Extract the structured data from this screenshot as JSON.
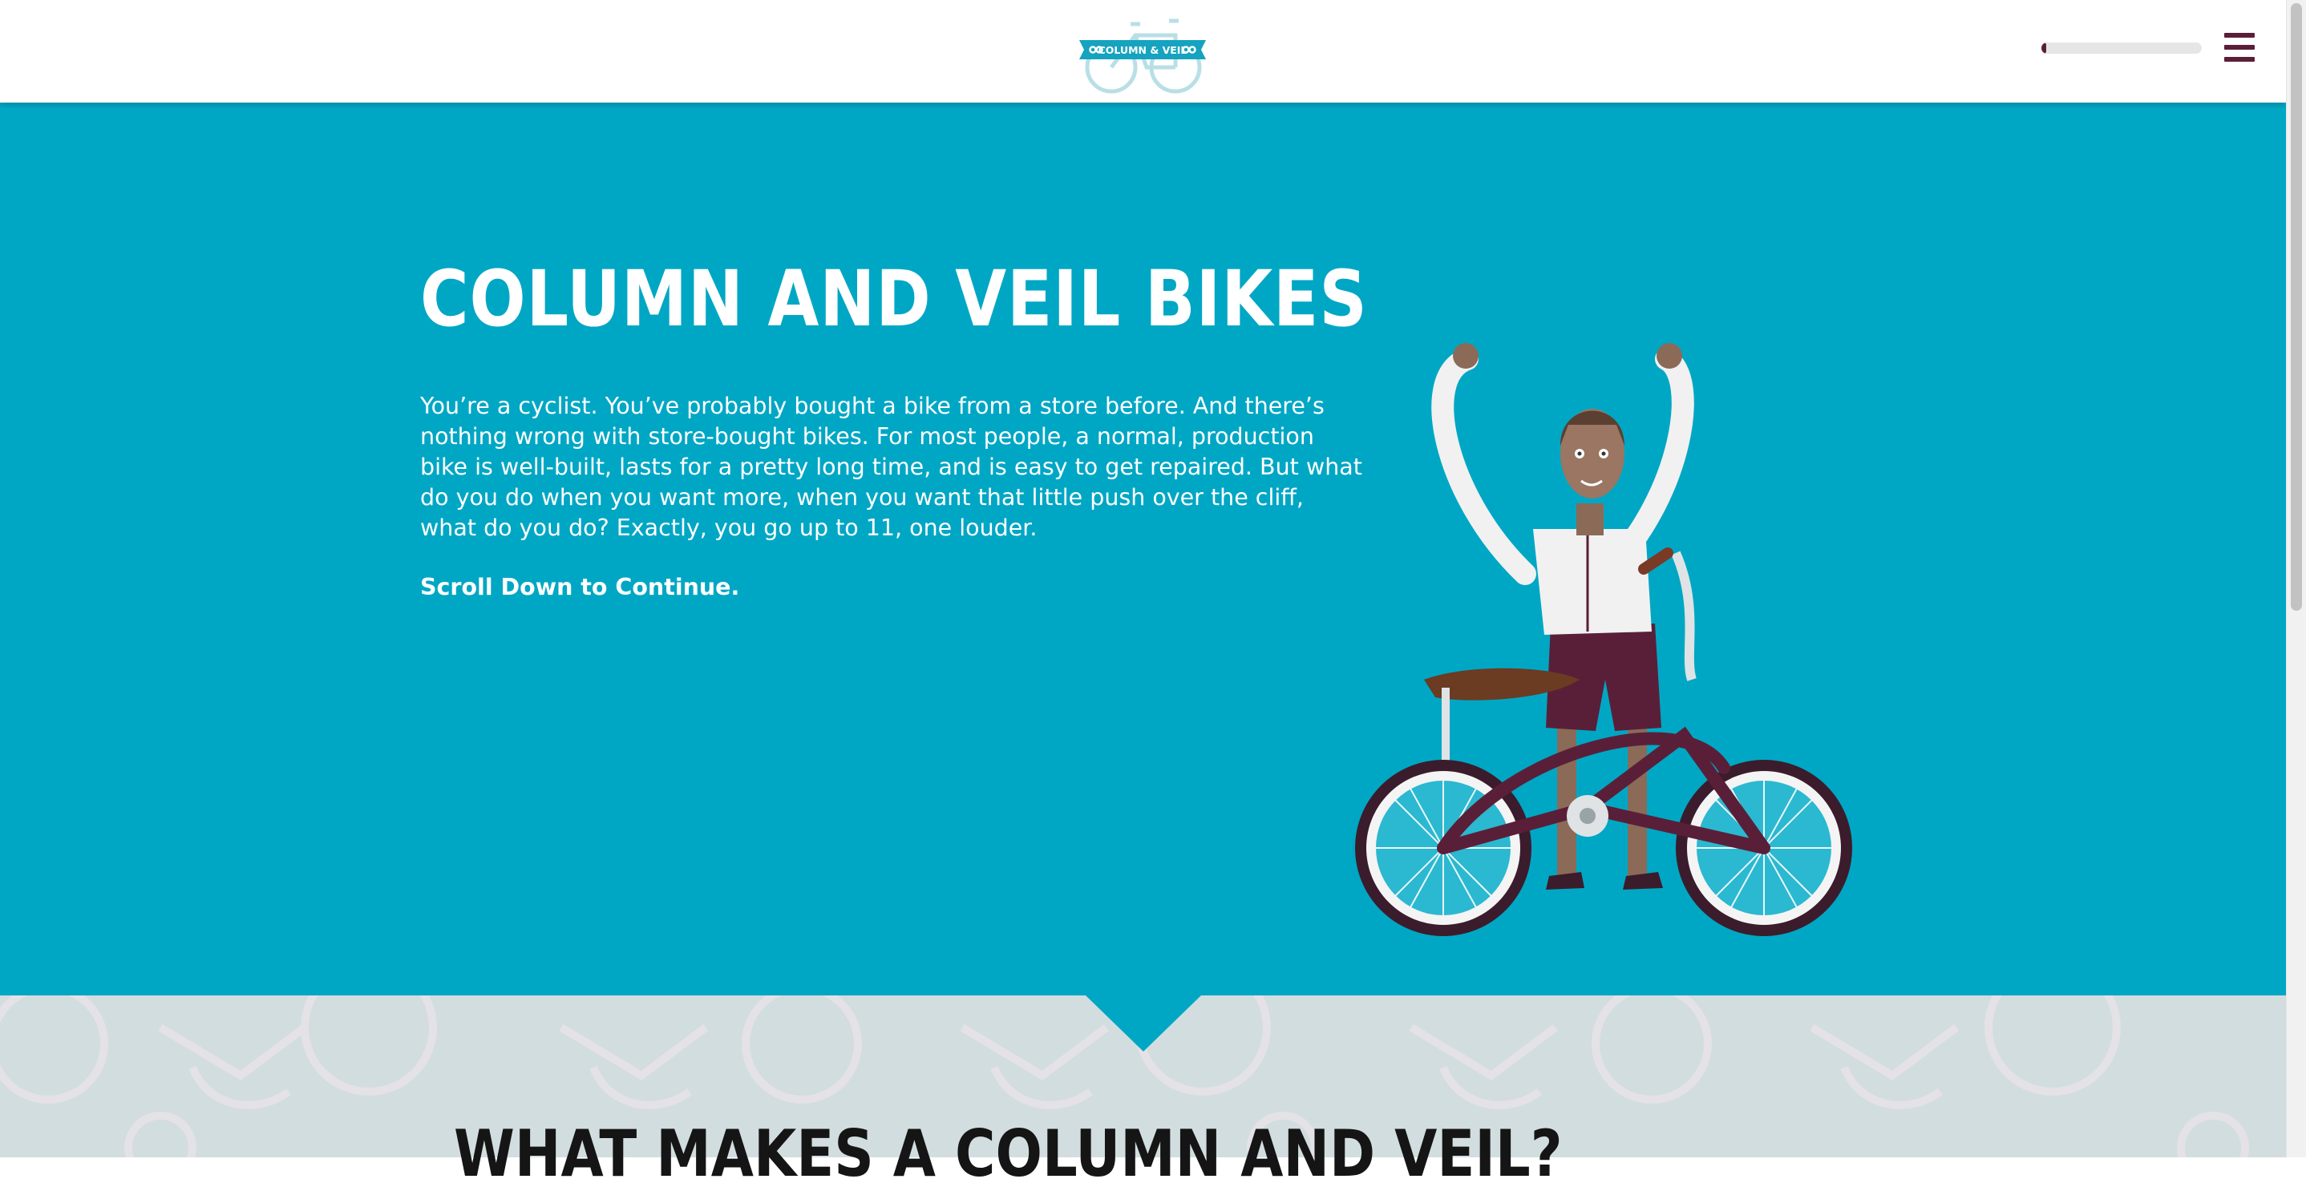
{
  "header": {
    "logo_text": "COLUMN & VEIL",
    "progress_percent": 3,
    "menu_icon": "hamburger-icon"
  },
  "hero": {
    "title": "COLUMN AND VEIL BIKES",
    "body": "You’re a cyclist. You’ve probably bought a bike from a store before. And there’s nothing wrong with store-bought bikes. For most people, a normal, production bike is well-built, lasts for a pretty long time, and is easy to get repaired. But what do you do when you want more, when you want that little push over the cliff, what do you do? Exactly, you go up to 11, one louder.",
    "scroll_prompt": "Scroll Down to Continue.",
    "illustration": "cyclist-with-bike"
  },
  "section2": {
    "title": "WHAT MAKES A COLUMN AND VEIL?"
  },
  "colors": {
    "hero_bg": "#00a7c4",
    "accent": "#5a1f38",
    "section2_bg": "#d2dddf",
    "header_bg": "#ffffff"
  }
}
